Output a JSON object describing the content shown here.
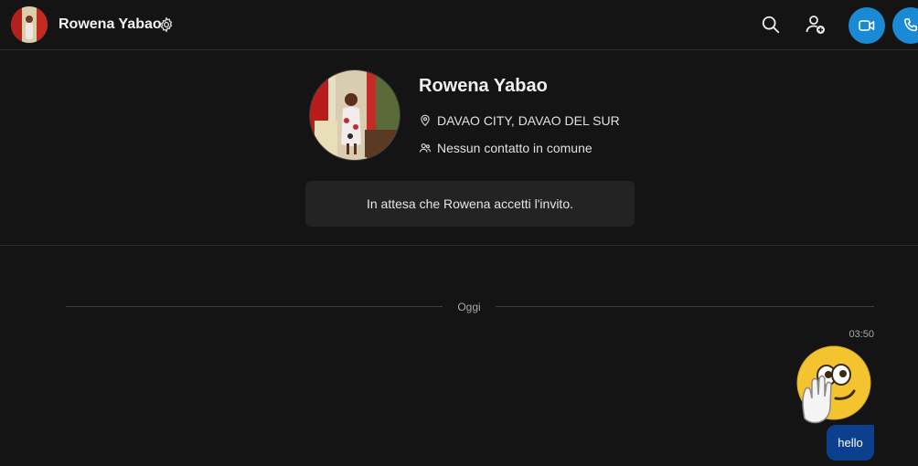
{
  "header": {
    "contact_name": "Rowena Yabao",
    "icons": [
      "settings-gear-icon",
      "search-icon",
      "add-person-icon",
      "video-camera-icon",
      "phone-icon"
    ],
    "accent_color": "#1a8ad4"
  },
  "profile": {
    "name": "Rowena Yabao",
    "location": "DAVAO CITY, DAVAO DEL SUR",
    "mutual_contacts": "Nessun contatto in comune",
    "invite_status": "In attesa che Rowena accetti l'invito."
  },
  "conversation": {
    "date_divider": "Oggi",
    "messages": [
      {
        "time": "03:50",
        "sticker": "wave-emoji",
        "text": "hello",
        "bubble_color": "#0d3f8f"
      }
    ]
  }
}
